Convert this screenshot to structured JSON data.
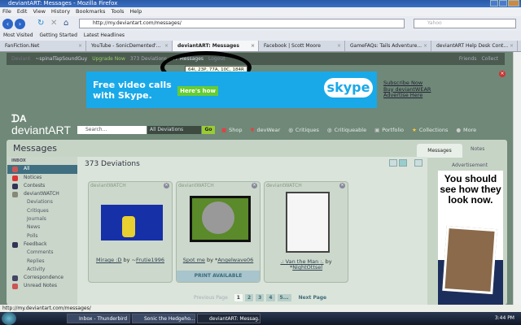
{
  "window": {
    "title": "deviantART: Messages - Mozilla Firefox"
  },
  "menu": [
    "File",
    "Edit",
    "View",
    "History",
    "Bookmarks",
    "Tools",
    "Help"
  ],
  "nav": {
    "url": "http://my.deviantart.com/messages/",
    "search_placeholder": "Yahoo"
  },
  "bookmarks": [
    "Most Visited",
    "Getting Started",
    "Latest Headlines"
  ],
  "tabs": [
    "FanFiction.Net",
    "YouTube - SonicDemented'...",
    "deviantART: Messages",
    "Facebook | Scott Moore",
    "GameFAQs: Tails Adventure...",
    "deviantART Help Desk Cont..."
  ],
  "datop": {
    "deviant_label": "Deviant",
    "user": "~spinalTapSoundGuy",
    "upgrade": "Upgrade Now",
    "deviations": "373 Deviations",
    "messages": "87 Messages",
    "logout": "Logout",
    "friends": "Friends",
    "collect": "Collect",
    "tooltip": "64I, 23P, 77A, 10C, 184R"
  },
  "ad": {
    "text1": "Free video calls",
    "text2": "with Skype.",
    "button": "Here's how",
    "brand": "skype",
    "links": [
      "Subscribe Now",
      "Buy deviantWEAR",
      "Advertise Here"
    ]
  },
  "header": {
    "logo": "deviantART",
    "search_placeholder": "Search...",
    "category": "All Deviations",
    "go": "Go",
    "nav": [
      "Shop",
      "devWear",
      "Critiques",
      "Critiqueable",
      "Portfolio",
      "Collections",
      "More"
    ]
  },
  "panel": {
    "title": "Messages",
    "tabs": [
      "Messages",
      "Notes"
    ]
  },
  "sidebar": [
    {
      "label": "INBOX",
      "type": "hd"
    },
    {
      "label": "All",
      "type": "active"
    },
    {
      "label": "Notices"
    },
    {
      "label": "Contests"
    },
    {
      "label": "deviantWATCH"
    },
    {
      "label": "Deviations",
      "type": "sub"
    },
    {
      "label": "Critiques",
      "type": "sub"
    },
    {
      "label": "Journals",
      "type": "sub"
    },
    {
      "label": "News",
      "type": "sub"
    },
    {
      "label": "Polls",
      "type": "sub"
    },
    {
      "label": "Feedback"
    },
    {
      "label": "Comments",
      "type": "sub"
    },
    {
      "label": "Replies",
      "type": "sub"
    },
    {
      "label": "Activity",
      "type": "sub"
    },
    {
      "label": "Correspondence"
    },
    {
      "label": "Unread Notes"
    }
  ],
  "main": {
    "title": "373 Deviations",
    "cards": [
      {
        "label": "deviantWATCH",
        "title": "Mirage :D",
        "by": "by ~",
        "artist": "Frutie1996"
      },
      {
        "label": "deviantWATCH",
        "title": "Spot me",
        "by": "by *",
        "artist": "Angelwave06",
        "print": "PRINT AVAILABLE"
      },
      {
        "label": "deviantWATCH",
        "title": ".: Van the Man :.",
        "by": "by *",
        "artist": "NightOttsel"
      }
    ],
    "pager": {
      "prev": "Previous Page",
      "pages": [
        "1",
        "2",
        "3",
        "4",
        "5..."
      ],
      "next": "Next Page"
    }
  },
  "right_ad": {
    "label": "Advertisement",
    "text": "You should see how they look now."
  },
  "status": "http://my.deviantart.com/messages/",
  "taskbar": {
    "items": [
      "Inbox - Thunderbird",
      "Sonic the Hedgeho...",
      "deviantART: Messag..."
    ],
    "clock": "3:44 PM"
  }
}
